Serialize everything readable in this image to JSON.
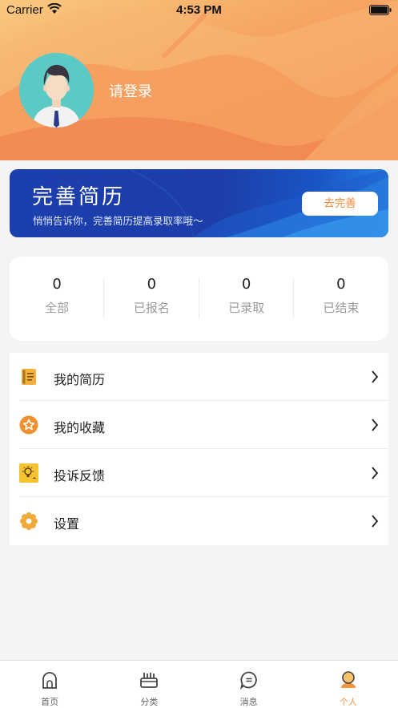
{
  "status_bar": {
    "carrier": "Carrier",
    "time": "4:53 PM"
  },
  "profile": {
    "login_prompt": "请登录"
  },
  "banner": {
    "title": "完善简历",
    "subtitle": "悄悄告诉你，完善简历提高录取率哦～",
    "button": "去完善"
  },
  "stats": [
    {
      "count": "0",
      "label": "全部"
    },
    {
      "count": "0",
      "label": "已报名"
    },
    {
      "count": "0",
      "label": "已录取"
    },
    {
      "count": "0",
      "label": "已结束"
    }
  ],
  "menu": [
    {
      "label": "我的简历",
      "icon": "resume-book-icon"
    },
    {
      "label": "我的收藏",
      "icon": "star-icon"
    },
    {
      "label": "投诉反馈",
      "icon": "lightbulb-icon"
    },
    {
      "label": "设置",
      "icon": "gear-icon"
    }
  ],
  "tabbar": [
    {
      "label": "首页",
      "icon": "home-icon",
      "active": false
    },
    {
      "label": "分类",
      "icon": "category-icon",
      "active": false
    },
    {
      "label": "消息",
      "icon": "message-icon",
      "active": false
    },
    {
      "label": "个人",
      "icon": "person-icon",
      "active": true
    }
  ],
  "colors": {
    "accent": "#f0963c",
    "header_gradient": [
      "#f9c97f",
      "#f1814d"
    ],
    "banner_blue": "#1d3ea8"
  }
}
